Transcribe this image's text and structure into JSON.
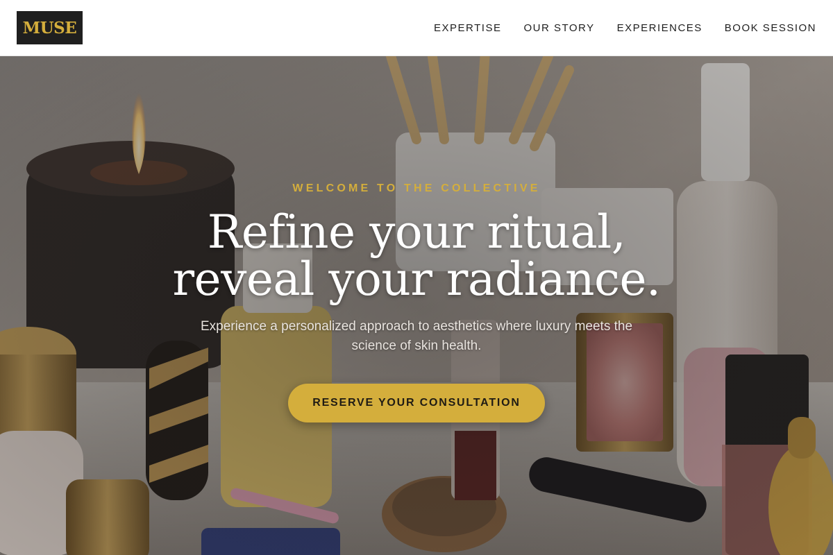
{
  "brand": {
    "logo_text": "MUSE",
    "accent_color": "#d4ae3c",
    "logo_bg_color": "#1f1f1f"
  },
  "nav": {
    "items": [
      {
        "label": "EXPERTISE"
      },
      {
        "label": "OUR STORY"
      },
      {
        "label": "EXPERIENCES"
      },
      {
        "label": "BOOK SESSION"
      }
    ]
  },
  "hero": {
    "eyebrow": "WELCOME TO THE COLLECTIVE",
    "headline_line1": "Refine your ritual,",
    "headline_line2": "reveal your radiance.",
    "subtitle": "Experience a personalized approach to aesthetics where luxury meets the science of skin health.",
    "cta_label": "RESERVE YOUR CONSULTATION",
    "background_image": "vanity-cosmetics-photo"
  }
}
